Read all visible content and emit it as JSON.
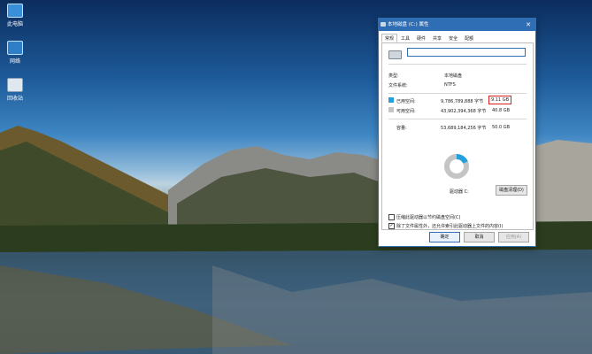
{
  "desktop": {
    "icons": [
      {
        "label": "此电脑",
        "glyph": "computer-icon"
      },
      {
        "label": "网络",
        "glyph": "network-icon"
      },
      {
        "label": "回收站",
        "glyph": "recycle-bin-icon"
      }
    ]
  },
  "dialog": {
    "title": "本地磁盘 (C:) 属性",
    "close_glyph": "✕",
    "tabs": [
      "常规",
      "工具",
      "硬件",
      "共享",
      "安全",
      "配额"
    ],
    "name_value": "",
    "type_label": "类型:",
    "type_value": "本地磁盘",
    "fs_label": "文件系统:",
    "fs_value": "NTFS",
    "used_label": "已用空间:",
    "used_bytes": "9,786,789,888 字节",
    "used_gb": "9.11 GB",
    "free_label": "可用空间:",
    "free_bytes": "43,902,394,368 字节",
    "free_gb": "40.8 GB",
    "capacity_label": "容量:",
    "capacity_bytes": "53,689,184,256 字节",
    "capacity_gb": "50.0 GB",
    "drive_label": "驱动器 C:",
    "cleanup_button": "磁盘清理(D)",
    "compress_label": "压缩此驱动器以节约磁盘空间(C)",
    "index_label": "除了文件属性外，还允许索引此驱动器上文件的内容(I)",
    "ok_button": "确定",
    "cancel_button": "取消",
    "apply_button": "应用(A)",
    "used_fraction": 0.182,
    "colors": {
      "used": "#26a0da",
      "free": "#c5c5c5",
      "highlight": "#e0201b"
    }
  }
}
